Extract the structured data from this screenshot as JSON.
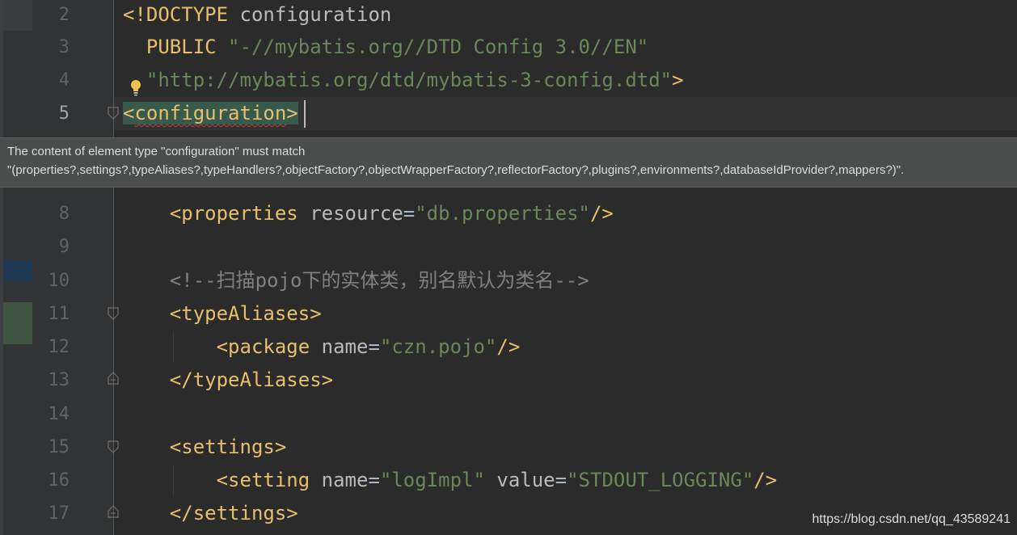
{
  "editor": {
    "lines": [
      {
        "num": "2",
        "parts": [
          {
            "cls": "tag",
            "text": "<!DOCTYPE "
          },
          {
            "cls": "attr",
            "text": "configuration"
          }
        ]
      },
      {
        "num": "3",
        "parts": [
          {
            "cls": "tag",
            "text": "  PUBLIC "
          },
          {
            "cls": "val",
            "text": "\"-//mybatis.org//DTD Config 3.0//EN\""
          }
        ]
      },
      {
        "num": "4",
        "parts": [
          {
            "cls": "val",
            "text": "  \"http://mybatis.org/dtd/mybatis-3-config.dtd\""
          },
          {
            "cls": "tag",
            "text": ">"
          }
        ]
      },
      {
        "num": "5",
        "parts": [
          {
            "cls": "tag hl-tag",
            "text": "<"
          },
          {
            "cls": "tag hl-tag squiggle",
            "text": "configuration"
          },
          {
            "cls": "tag hl-tag",
            "text": ">"
          }
        ]
      },
      {
        "num": "8",
        "parts": [
          {
            "cls": "tag",
            "text": "    <properties "
          },
          {
            "cls": "attr",
            "text": "resource"
          },
          {
            "cls": "eq",
            "text": "="
          },
          {
            "cls": "val",
            "text": "\"db.properties\""
          },
          {
            "cls": "tag",
            "text": "/>"
          }
        ]
      },
      {
        "num": "9",
        "parts": []
      },
      {
        "num": "10",
        "parts": [
          {
            "cls": "cmt",
            "text": "    <!--扫描pojo下的实体类，别名默认为类名-->"
          }
        ]
      },
      {
        "num": "11",
        "parts": [
          {
            "cls": "tag",
            "text": "    <typeAliases>"
          }
        ]
      },
      {
        "num": "12",
        "parts": [
          {
            "cls": "tag",
            "text": "        <package "
          },
          {
            "cls": "attr",
            "text": "name"
          },
          {
            "cls": "eq",
            "text": "="
          },
          {
            "cls": "val",
            "text": "\"czn.pojo\""
          },
          {
            "cls": "tag",
            "text": "/>"
          }
        ]
      },
      {
        "num": "13",
        "parts": [
          {
            "cls": "tag",
            "text": "    </typeAliases>"
          }
        ]
      },
      {
        "num": "14",
        "parts": []
      },
      {
        "num": "15",
        "parts": [
          {
            "cls": "tag",
            "text": "    <settings>"
          }
        ]
      },
      {
        "num": "16",
        "parts": [
          {
            "cls": "tag",
            "text": "        <setting "
          },
          {
            "cls": "attr",
            "text": "name"
          },
          {
            "cls": "eq",
            "text": "="
          },
          {
            "cls": "val",
            "text": "\"logImpl\""
          },
          {
            "cls": "attr",
            "text": " value"
          },
          {
            "cls": "eq",
            "text": "="
          },
          {
            "cls": "val",
            "text": "\"STDOUT_LOGGING\""
          },
          {
            "cls": "tag",
            "text": "/>"
          }
        ]
      },
      {
        "num": "17",
        "parts": [
          {
            "cls": "tag",
            "text": "    </settings>"
          }
        ]
      }
    ],
    "current_line": "5"
  },
  "tooltip": {
    "line1": "The content of element type \"configuration\" must match",
    "line2": "\"(properties?,settings?,typeAliases?,typeHandlers?,objectFactory?,objectWrapperFactory?,reflectorFactory?,plugins?,environments?,databaseIdProvider?,mappers?)\"."
  },
  "watermark": "https://blog.csdn.net/qq_43589241",
  "colors": {
    "background": "#2b2b2b",
    "tag": "#e8bf6a",
    "string": "#6a8759",
    "comment": "#808080",
    "tooltip_bg": "#4b4d4d"
  },
  "icons": [
    "lightbulb-icon",
    "fold-icon"
  ]
}
